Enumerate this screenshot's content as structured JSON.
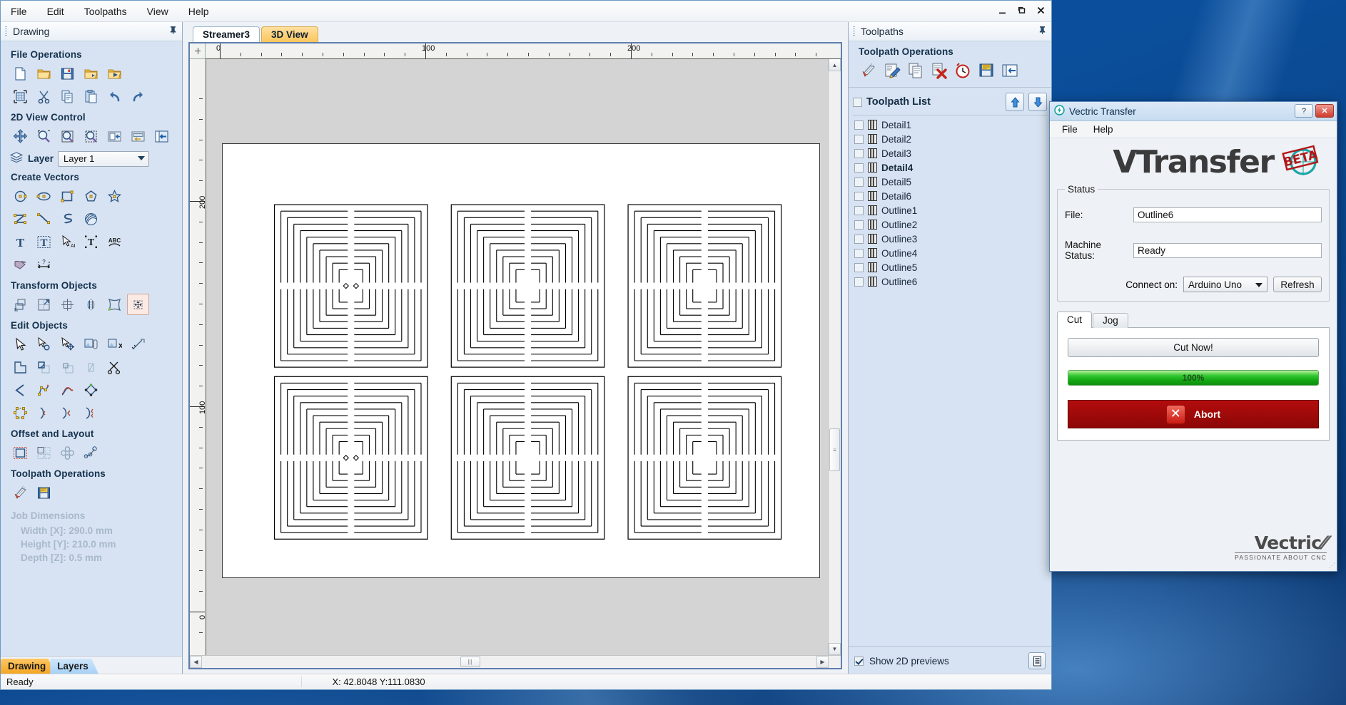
{
  "app": {
    "menu": [
      "File",
      "Edit",
      "Toolpaths",
      "View",
      "Help"
    ],
    "window_buttons": {
      "minimize": "—",
      "maximize": "❐",
      "close": "✕"
    },
    "status_bar": {
      "left": "Ready",
      "coords": "X: 42.8048 Y:111.0830"
    }
  },
  "left_panel": {
    "caption": "Drawing",
    "pin_icon": "pin-icon",
    "groups": [
      {
        "title": "File Operations",
        "icons": [
          [
            "new-file-icon",
            "open-folder-icon",
            "save-icon",
            "open-recent-icon",
            "import-icon"
          ],
          [
            "job-setup-icon",
            "cut-icon",
            "copy-icon",
            "paste-icon",
            "undo-icon",
            "redo-icon"
          ]
        ]
      },
      {
        "title": "2D View Control",
        "icons": [
          [
            "pan-icon",
            "zoom-in-icon",
            "zoom-selected-icon",
            "zoom-box-icon",
            "zoom-drawing-icon",
            "zoom-extents-icon",
            "toggle-panel-icon"
          ]
        ]
      }
    ],
    "layer": {
      "label": "Layer",
      "value": "Layer 1",
      "icon": "layers-icon"
    },
    "create_vectors": {
      "title": "Create Vectors",
      "icons": [
        [
          "circle-icon",
          "ellipse-icon",
          "rectangle-icon",
          "polygon-icon",
          "star-icon"
        ],
        [
          "polyline-icon",
          "curve-icon",
          "spiral-icon",
          "texture-icon"
        ],
        [
          "text-icon",
          "text-box-icon",
          "text-select-icon",
          "text-on-curve-icon",
          "text-arc-icon"
        ],
        [
          "trace-bitmap-icon",
          "dimension-icon"
        ]
      ]
    },
    "transform_objects": {
      "title": "Transform Objects",
      "icons": [
        [
          "move-icon",
          "scale-icon",
          "rotate-icon",
          "mirror-icon",
          "distort-icon",
          "align-icon"
        ]
      ]
    },
    "edit_objects": {
      "title": "Edit Objects",
      "icons": [
        [
          "select-icon",
          "node-edit-icon",
          "move-nodes-icon",
          "group-icon",
          "ungroup-icon",
          "measure-icon"
        ],
        [
          "weld-icon",
          "subtract-icon",
          "intersect-icon",
          "trim-icon",
          "scissors-icon"
        ],
        [
          "join-vectors-icon",
          "close-vectors-icon",
          "smooth-icon",
          "fit-curve-icon"
        ],
        [
          "nodes-icon",
          "fillet-icon",
          "chamfer-icon",
          "notch-icon"
        ]
      ]
    },
    "offset_layout": {
      "title": "Offset and Layout",
      "icons": [
        [
          "offset-icon",
          "array-copy-icon",
          "circular-copy-icon",
          "copy-along-curve-icon"
        ]
      ]
    },
    "toolpath_operations": {
      "title": "Toolpath Operations",
      "icons": [
        [
          "toolpath-icon",
          "save-toolpath-icon"
        ]
      ]
    },
    "job_dimensions": {
      "title": "Job Dimensions",
      "rows": [
        "Width  [X]: 290.0 mm",
        "Height [Y]: 210.0 mm",
        "Depth  [Z]: 0.5 mm"
      ]
    },
    "tabs": [
      {
        "label": "Drawing",
        "active": true
      },
      {
        "label": "Layers",
        "active": false
      }
    ]
  },
  "center": {
    "tabs": [
      {
        "label": "Streamer3",
        "active": true
      },
      {
        "label": "3D View",
        "active": false
      }
    ],
    "h_ruler_labels": [
      "0",
      "100",
      "200"
    ],
    "v_ruler_labels": [
      "0",
      "100",
      "200"
    ],
    "drawing": {
      "description": "six concentric-square maze tiles arranged in 2 rows by 3 columns",
      "rows": 2,
      "cols": 3,
      "rings": 11
    },
    "scroll": {
      "h_thumb": "scrollbar-thumb",
      "v_thumb": "scrollbar-thumb"
    }
  },
  "right_panel": {
    "caption": "Toolpaths",
    "pin_icon": "pin-icon",
    "operations_title": "Toolpath Operations",
    "operation_icons": [
      "new-toolpath-icon",
      "edit-toolpath-icon",
      "duplicate-toolpath-icon",
      "delete-toolpath-icon",
      "estimate-time-icon",
      "save-toolpath-icon",
      "toolpath-summary-icon"
    ],
    "list_header": {
      "label": "Toolpath List",
      "checked": false
    },
    "move_up_icon": "arrow-up-icon",
    "move_down_icon": "arrow-down-icon",
    "toolpaths": [
      {
        "name": "Detail1",
        "checked": false,
        "bold": false
      },
      {
        "name": "Detail2",
        "checked": false,
        "bold": false
      },
      {
        "name": "Detail3",
        "checked": false,
        "bold": false
      },
      {
        "name": "Detail4",
        "checked": false,
        "bold": true
      },
      {
        "name": "Detail5",
        "checked": false,
        "bold": false
      },
      {
        "name": "Detail6",
        "checked": false,
        "bold": false
      },
      {
        "name": "Outline1",
        "checked": false,
        "bold": false
      },
      {
        "name": "Outline2",
        "checked": false,
        "bold": false
      },
      {
        "name": "Outline3",
        "checked": false,
        "bold": false
      },
      {
        "name": "Outline4",
        "checked": false,
        "bold": false
      },
      {
        "name": "Outline5",
        "checked": false,
        "bold": false
      },
      {
        "name": "Outline6",
        "checked": false,
        "bold": false
      }
    ],
    "show_previews": {
      "label": "Show 2D previews",
      "checked": true
    },
    "summary_button_icon": "list-view-icon"
  },
  "vtransfer": {
    "title": "Vectric Transfer",
    "title_icon": "vtransfer-icon",
    "help_button": "?",
    "close_button": "✕",
    "menu": [
      "File",
      "Help"
    ],
    "logo_text": "VTransfer",
    "beta_badge": "BETA",
    "status_group": "Status",
    "file": {
      "label": "File:",
      "value": "Outline6"
    },
    "machine_status": {
      "label": "Machine Status:",
      "value": "Ready"
    },
    "connect": {
      "label": "Connect on:",
      "value": "Arduino Uno",
      "refresh_label": "Refresh"
    },
    "tabs": [
      {
        "label": "Cut",
        "active": true
      },
      {
        "label": "Jog",
        "active": false
      }
    ],
    "cut_now_label": "Cut Now!",
    "progress": {
      "percent": 100,
      "text": "100%",
      "color": "#22bb22"
    },
    "abort_label": "Abort",
    "abort_icon": "x-icon",
    "brand": {
      "name": "Vectric",
      "tagline": "PASSIONATE ABOUT CNC"
    }
  }
}
